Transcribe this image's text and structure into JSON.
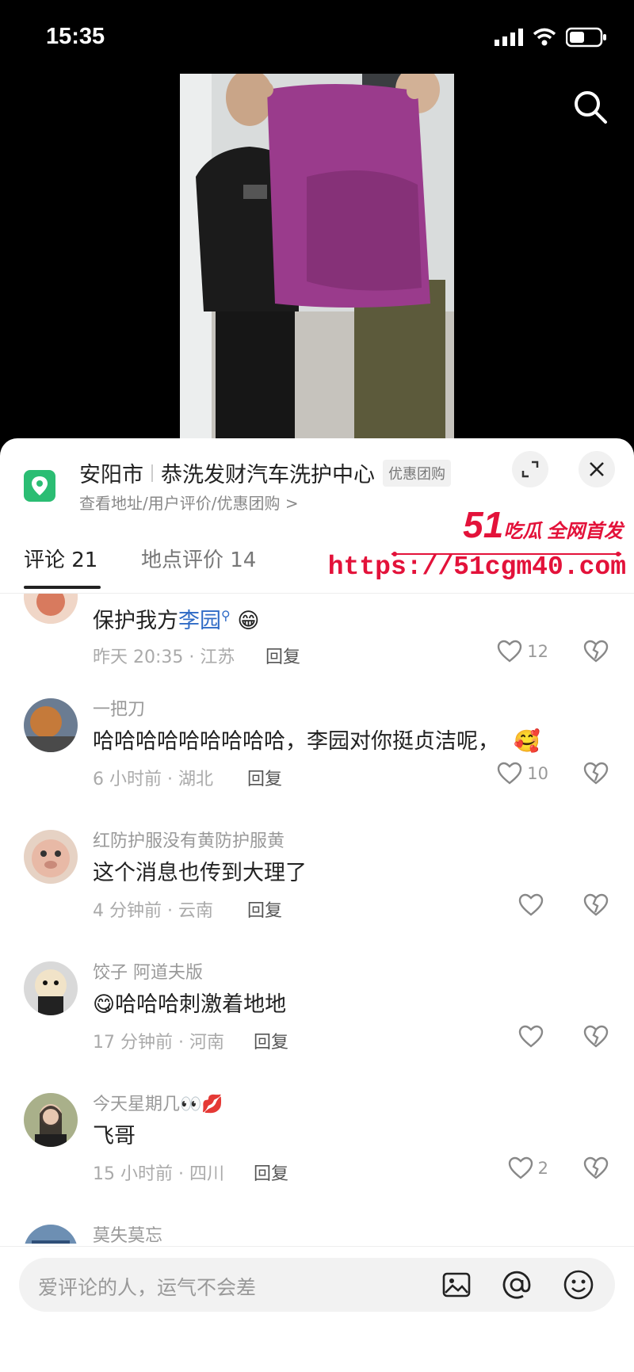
{
  "status": {
    "time": "15:35"
  },
  "location": {
    "city": "安阳市",
    "name": "恭洗发财汽车洗护中心",
    "tag": "优惠团购",
    "sub": "查看地址/用户评价/优惠团购 >"
  },
  "tabs": {
    "comments": "评论 21",
    "place_reviews": "地点评价 14"
  },
  "watermark": {
    "num": "51",
    "brand": "吃瓜 全网首发",
    "url": "https://51cgm40.com"
  },
  "comments": [
    {
      "user": "",
      "text_pre": "保护我方",
      "text_link": "李园",
      "emoji": "😁",
      "time": "昨天 20:35 · 江苏",
      "reply": "回复",
      "likes": "12"
    },
    {
      "user": "一把刀",
      "text": "哈哈哈哈哈哈哈哈哈，李园对你挺贞洁呢，",
      "emoji": "🥰",
      "time": "6 小时前 · 湖北",
      "reply": "回复",
      "likes": "10"
    },
    {
      "user": "红防护服没有黄防护服黄",
      "text": "这个消息也传到大理了",
      "time": "4 分钟前 · 云南",
      "reply": "回复",
      "likes": ""
    },
    {
      "user": "饺子 阿道夫版",
      "emoji": "😋",
      "text": "哈哈哈刺激着地地",
      "time": "17 分钟前 · 河南",
      "reply": "回复",
      "likes": ""
    },
    {
      "user": "今天星期几👀💋",
      "text": "飞哥",
      "time": "15 小时前 · 四川",
      "reply": "回复",
      "likes": "2"
    },
    {
      "user": "莫失莫忘"
    }
  ],
  "input": {
    "placeholder": "爱评论的人，运气不会差"
  },
  "colors": {
    "accent_red": "#e3123a",
    "pin_green": "#2bbd73",
    "link_blue": "#2f6bc6"
  }
}
